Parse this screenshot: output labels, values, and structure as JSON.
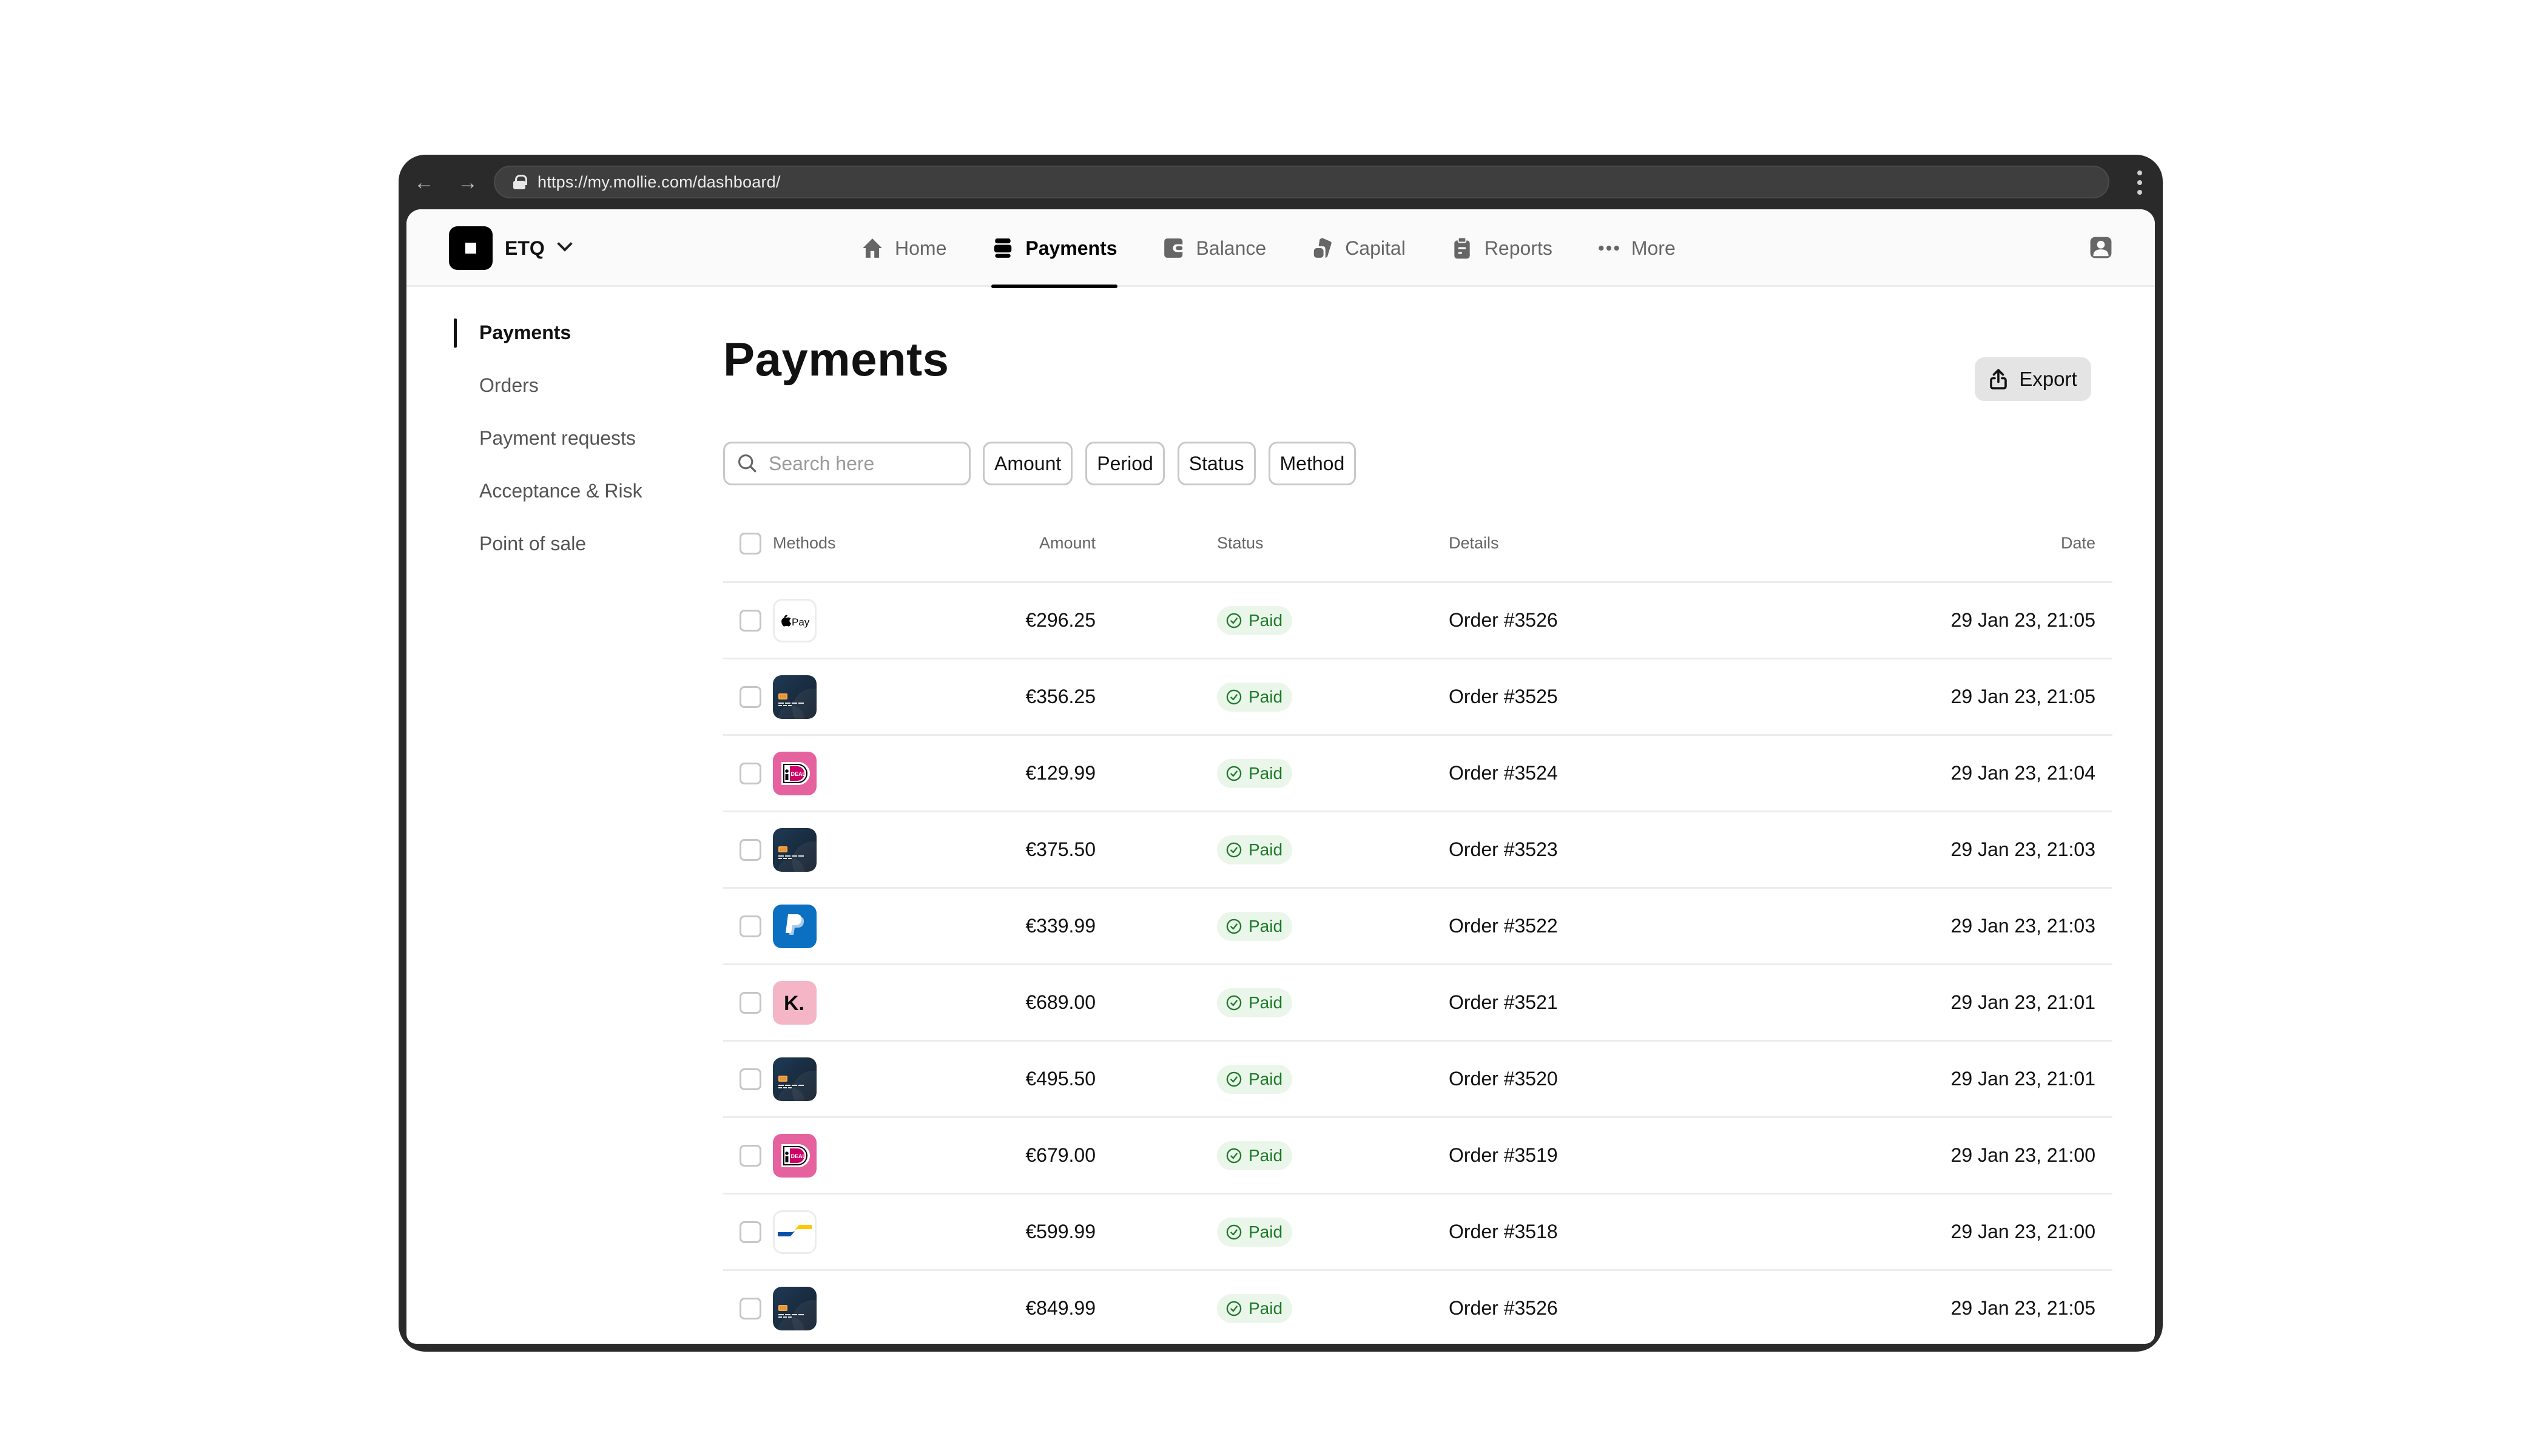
{
  "browser": {
    "url": "https://my.mollie.com/dashboard/",
    "back_icon": "arrow-left-icon",
    "forward_icon": "arrow-right-icon",
    "lock_icon": "lock-icon",
    "menu_icon": "kebab-menu-icon"
  },
  "header": {
    "org_name": "ETQ",
    "org_icon": "org-logo-icon",
    "nav": [
      {
        "label": "Home",
        "icon": "home-icon",
        "active": false
      },
      {
        "label": "Payments",
        "icon": "payments-icon",
        "active": true
      },
      {
        "label": "Balance",
        "icon": "balance-icon",
        "active": false
      },
      {
        "label": "Capital",
        "icon": "capital-icon",
        "active": false
      },
      {
        "label": "Reports",
        "icon": "reports-icon",
        "active": false
      },
      {
        "label": "More",
        "icon": "more-dots-icon",
        "active": false
      }
    ],
    "account_icon": "user-account-icon"
  },
  "sidebar": {
    "items": [
      {
        "label": "Payments",
        "active": true
      },
      {
        "label": "Orders",
        "active": false
      },
      {
        "label": "Payment requests",
        "active": false
      },
      {
        "label": "Acceptance & Risk",
        "active": false
      },
      {
        "label": "Point of sale",
        "active": false
      }
    ]
  },
  "main": {
    "title": "Payments",
    "export_label": "Export",
    "search": {
      "placeholder": "Search here",
      "value": ""
    },
    "filters": [
      "Amount",
      "Period",
      "Status",
      "Method"
    ],
    "table": {
      "columns": {
        "methods": "Methods",
        "amount": "Amount",
        "status": "Status",
        "details": "Details",
        "date": "Date"
      },
      "rows": [
        {
          "method": "apple-pay",
          "amount": "€296.25",
          "status": "Paid",
          "details": "Order #3526",
          "date": "29 Jan 23, 21:05"
        },
        {
          "method": "credit-card",
          "amount": "€356.25",
          "status": "Paid",
          "details": "Order #3525",
          "date": "29 Jan 23, 21:05"
        },
        {
          "method": "ideal",
          "amount": "€129.99",
          "status": "Paid",
          "details": "Order #3524",
          "date": "29 Jan 23, 21:04"
        },
        {
          "method": "credit-card",
          "amount": "€375.50",
          "status": "Paid",
          "details": "Order #3523",
          "date": "29 Jan 23, 21:03"
        },
        {
          "method": "paypal",
          "amount": "€339.99",
          "status": "Paid",
          "details": "Order #3522",
          "date": "29 Jan 23, 21:03"
        },
        {
          "method": "klarna",
          "amount": "€689.00",
          "status": "Paid",
          "details": "Order #3521",
          "date": "29 Jan 23, 21:01"
        },
        {
          "method": "credit-card",
          "amount": "€495.50",
          "status": "Paid",
          "details": "Order #3520",
          "date": "29 Jan 23, 21:01"
        },
        {
          "method": "ideal",
          "amount": "€679.00",
          "status": "Paid",
          "details": "Order #3519",
          "date": "29 Jan 23, 21:00"
        },
        {
          "method": "bancontact",
          "amount": "€599.99",
          "status": "Paid",
          "details": "Order #3518",
          "date": "29 Jan 23, 21:00"
        },
        {
          "method": "credit-card",
          "amount": "€849.99",
          "status": "Paid",
          "details": "Order #3526",
          "date": "29 Jan 23, 21:05"
        }
      ]
    }
  },
  "colors": {
    "frame": "#2a2a2a",
    "paid_text": "#1e7a2a",
    "paid_bg": "#eaf6ea",
    "ideal_pink": "#e5629f",
    "paypal_blue": "#0b6fc2",
    "klarna_pink": "#f4b6c7",
    "card_navy": "#1c2f45"
  }
}
